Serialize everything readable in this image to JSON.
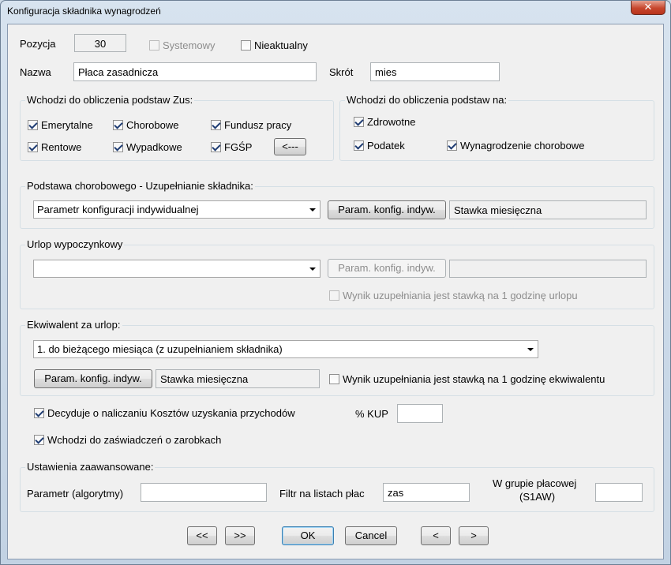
{
  "window": {
    "title": "Konfiguracja składnika wynagrodzeń",
    "close_glyph": "✕"
  },
  "top": {
    "pozycja_label": "Pozycja",
    "pozycja_value": "30",
    "systemowy_label": "Systemowy",
    "nieaktualny_label": "Nieaktualny",
    "nazwa_label": "Nazwa",
    "nazwa_value": "Płaca zasadnicza",
    "skrot_label": "Skrót",
    "skrot_value": "mies"
  },
  "zus": {
    "title": "Wchodzi do obliczenia podstaw Zus:",
    "emerytalne": "Emerytalne",
    "chorobowe": "Chorobowe",
    "fundusz": "Fundusz pracy",
    "rentowe": "Rentowe",
    "wypadkowe": "Wypadkowe",
    "fgsp": "FGŚP",
    "arrow_button": "<---"
  },
  "podstawy": {
    "title": "Wchodzi do obliczenia podstaw na:",
    "zdrowotne": "Zdrowotne",
    "podatek": "Podatek",
    "wynagrodzenie": "Wynagrodzenie chorobowe"
  },
  "chorobowe_grp": {
    "title": "Podstawa chorobowego - Uzupełnianie składnika:",
    "combo_value": "Parametr konfiguracji indywidualnej",
    "param_button": "Param. konfig. indyw.",
    "stawka": "Stawka miesięczna"
  },
  "urlop": {
    "title": "Urlop wypoczynkowy",
    "combo_value": "",
    "param_button": "Param. konfig. indyw.",
    "stawka": "",
    "wynik_label": "Wynik uzupełniania jest stawką na 1 godzinę urlopu"
  },
  "ekwiwalent": {
    "title": "Ekwiwalent za urlop:",
    "combo_value": "1. do bieżącego miesiąca (z uzupełnianiem składnika)",
    "param_button": "Param. konfig. indyw.",
    "stawka": "Stawka miesięczna",
    "wynik_label": "Wynik uzupełniania jest stawką na 1 godzinę ekwiwalentu"
  },
  "kup": {
    "decyduje_label": "Decyduje o naliczaniu Kosztów uzyskania przychodów",
    "kup_label": "% KUP",
    "kup_value": "",
    "zaswiadczen_label": "Wchodzi do zaświadczeń o zarobkach"
  },
  "advanced": {
    "title": "Ustawienia zaawansowane:",
    "parametr_label": "Parametr (algorytmy)",
    "parametr_value": "",
    "filtr_label": "Filtr na listach płac",
    "filtr_value": "zas",
    "grupa_label_1": "W grupie płacowej",
    "grupa_label_2": "(S1AW)",
    "grupa_value": ""
  },
  "footer": {
    "first": "<<",
    "next_page": ">>",
    "ok": "OK",
    "cancel": "Cancel",
    "prev": "<",
    "next": ">"
  }
}
